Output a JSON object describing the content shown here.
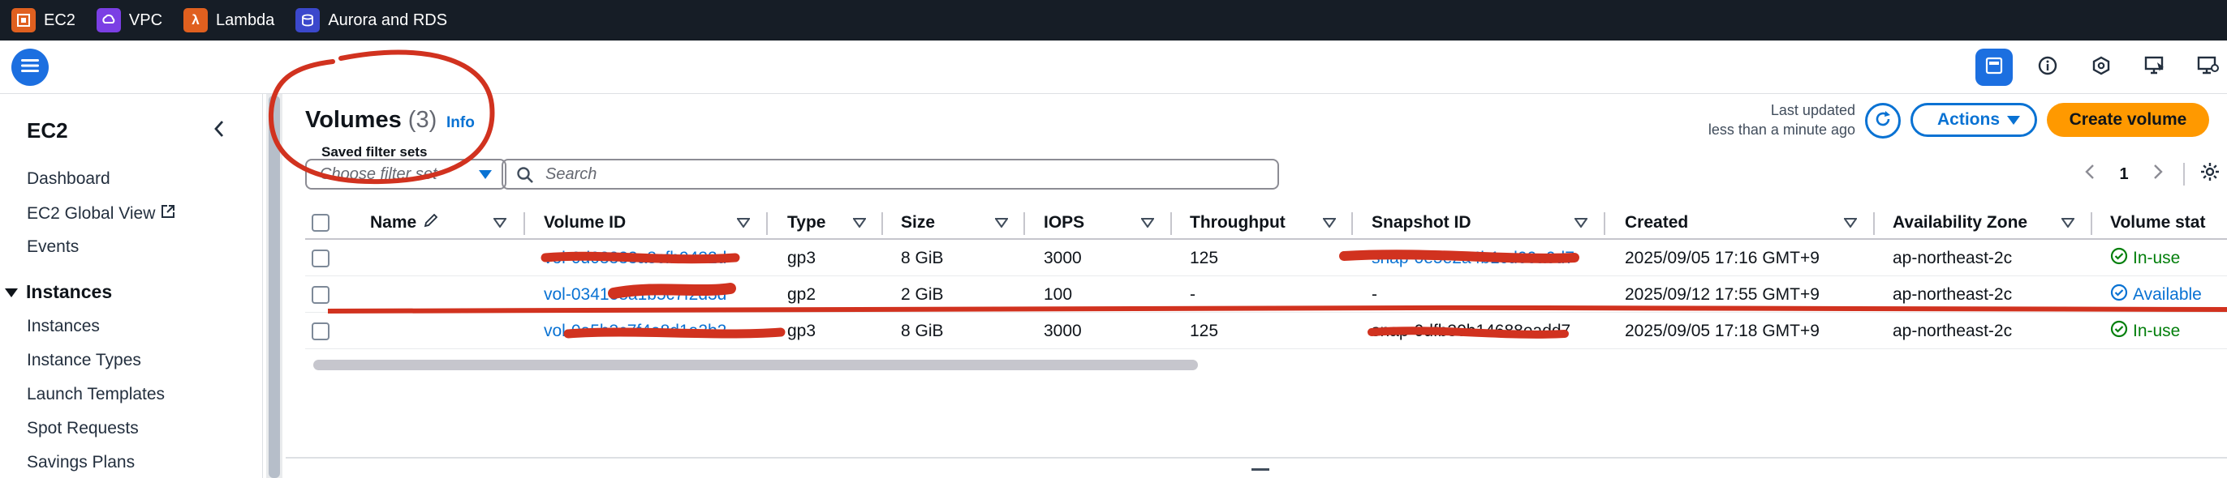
{
  "services": [
    {
      "label": "EC2",
      "icon": "ec2-icon",
      "color": "#e0601f"
    },
    {
      "label": "VPC",
      "icon": "vpc-icon",
      "color": "#7b3fe4"
    },
    {
      "label": "Lambda",
      "icon": "lambda-icon",
      "color": "#e0601f"
    },
    {
      "label": "Aurora and RDS",
      "icon": "rds-icon",
      "color": "#3b48cc"
    }
  ],
  "sidebar": {
    "title": "EC2",
    "items": [
      "Dashboard",
      "EC2 Global View",
      "Events"
    ],
    "section": "Instances",
    "section_items": [
      "Instances",
      "Instance Types",
      "Launch Templates",
      "Spot Requests",
      "Savings Plans"
    ]
  },
  "header": {
    "title": "Volumes",
    "count": "(3)",
    "info": "Info",
    "saved_filter_sets": "Saved filter sets",
    "last_updated_line1": "Last updated",
    "last_updated_line2": "less than a minute ago",
    "actions_label": "Actions",
    "create_label": "Create volume"
  },
  "filters": {
    "filter_set_placeholder": "Choose filter set",
    "search_placeholder": "Search",
    "page": "1"
  },
  "table": {
    "columns": [
      "Name",
      "Volume ID",
      "Type",
      "Size",
      "IOPS",
      "Throughput",
      "Snapshot ID",
      "Created",
      "Availability Zone",
      "Volume stat"
    ],
    "rows": [
      {
        "name": "",
        "volume_id": "vol-0d03333a8cfb9432d",
        "type": "gp3",
        "size": "8 GiB",
        "iops": "3000",
        "throughput": "125",
        "snapshot_id": "snap-0e5e2a4b1cd00a0d7",
        "created": "2025/09/05 17:16 GMT+9",
        "az": "ap-northeast-2c",
        "status": "In-use"
      },
      {
        "name": "",
        "volume_id": "vol-0341e8a1b5c7f2d3d",
        "type": "gp2",
        "size": "2 GiB",
        "iops": "100",
        "throughput": "-",
        "snapshot_id": "-",
        "created": "2025/09/12 17:55 GMT+9",
        "az": "ap-northeast-2c",
        "status": "Available"
      },
      {
        "name": "",
        "volume_id": "vol-0a5b3c7f4e8d1a2b2",
        "type": "gp3",
        "size": "8 GiB",
        "iops": "3000",
        "throughput": "125",
        "snapshot_id": "snap-0dfb30b14688eadd7",
        "created": "2025/09/05 17:18 GMT+9",
        "az": "ap-northeast-2c",
        "status": "In-use"
      }
    ]
  },
  "colors": {
    "accent": "#0972d3",
    "primary_button": "#ff9900",
    "in_use": "#037f0c",
    "annotation": "#d1321f"
  }
}
